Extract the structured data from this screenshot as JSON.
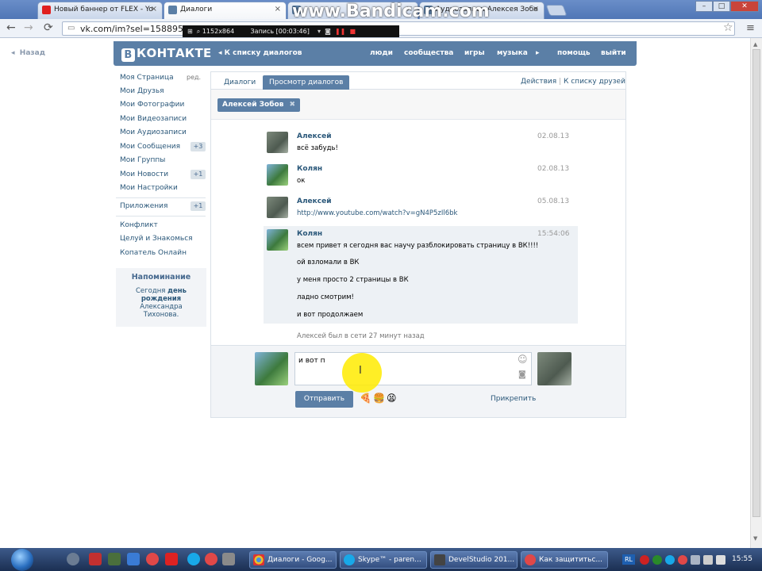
{
  "browser": {
    "tabs": [
      {
        "label": "Новый баннер от FLEX - Yo",
        "icon": "youtube-icon",
        "active": false
      },
      {
        "label": "Диалоги",
        "icon": "vk-icon",
        "active": true
      },
      {
        "label": "",
        "icon": "vk-icon",
        "active": false
      },
      {
        "label": "Аудиозаписи Алексея Зобо",
        "icon": "vk-icon",
        "active": false
      }
    ],
    "url": "vk.com/im?sel=1588958",
    "window_buttons": [
      "–",
      "□",
      "✕"
    ]
  },
  "recorder": {
    "resolution": "1152x864",
    "status": "Запись [00:03:46]",
    "watermark": "www.Bandicam.com"
  },
  "page": {
    "back_label": "Назад",
    "logo_letter": "B",
    "logo_text": "КОНТАКТЕ",
    "back_to_dialogs": "К списку диалогов",
    "top_nav": [
      "люди",
      "сообщества",
      "игры",
      "музыка",
      "помощь",
      "выйти"
    ]
  },
  "left_menu": {
    "edit_label": "ред.",
    "items": [
      {
        "label": "Моя Страница",
        "count": ""
      },
      {
        "label": "Мои Друзья",
        "count": ""
      },
      {
        "label": "Мои Фотографии",
        "count": ""
      },
      {
        "label": "Мои Видеозаписи",
        "count": ""
      },
      {
        "label": "Мои Аудиозаписи",
        "count": ""
      },
      {
        "label": "Мои Сообщения",
        "count": "+3"
      },
      {
        "label": "Мои Группы",
        "count": ""
      },
      {
        "label": "Мои Новости",
        "count": "+1"
      },
      {
        "label": "Мои Настройки",
        "count": ""
      }
    ],
    "apps": {
      "label": "Приложения",
      "count": "+1"
    },
    "app_items": [
      "Конфликт",
      "Целуй и Знакомься",
      "Копатель Онлайн"
    ],
    "reminder": {
      "title": "Напоминание",
      "text_before": "Сегодня ",
      "text_bold": "день рождения",
      "text_after": " Александра Тихонова."
    }
  },
  "dialogs": {
    "tabs": [
      "Диалоги",
      "Просмотр диалогов"
    ],
    "actions_label": "Действия",
    "separator": "|",
    "friends_link": "К списку друзей",
    "filter_chip": "Алексей Зобов",
    "messages": [
      {
        "author": "Алексей",
        "date": "02.08.13",
        "lines": [
          "всё забудь!"
        ]
      },
      {
        "author": "Колян",
        "date": "02.08.13",
        "lines": [
          "ок"
        ]
      },
      {
        "author": "Алексей",
        "date": "05.08.13",
        "lines": [
          "http://www.youtube.com/watch?v=gN4P5zIl6bk"
        ]
      },
      {
        "author": "Колян",
        "date": "15:54:06",
        "lines": [
          "всем привет я сегодня вас научу разблокировать страницу в ВК!!!!",
          "ой взломали в ВК",
          "у меня просто 2 страницы в ВК",
          "ладно смотрим!",
          "и вот продолжаем"
        ]
      }
    ],
    "last_seen": "Алексей был в сети 27 минут назад",
    "composer": {
      "input_value": "и вот п",
      "send_label": "Отправить",
      "attach_label": "Прикрепить"
    }
  },
  "taskbar": {
    "windows": [
      {
        "label": "Диалоги - Goog...",
        "icon": "chrome-icon"
      },
      {
        "label": "Skype™ - paren...",
        "icon": "skype-icon"
      },
      {
        "label": "DevelStudio 201...",
        "icon": "develstudio-icon"
      },
      {
        "label": "Как защититьс...",
        "icon": "yandex-icon"
      }
    ],
    "lang": "RL",
    "clock": "15:55"
  }
}
